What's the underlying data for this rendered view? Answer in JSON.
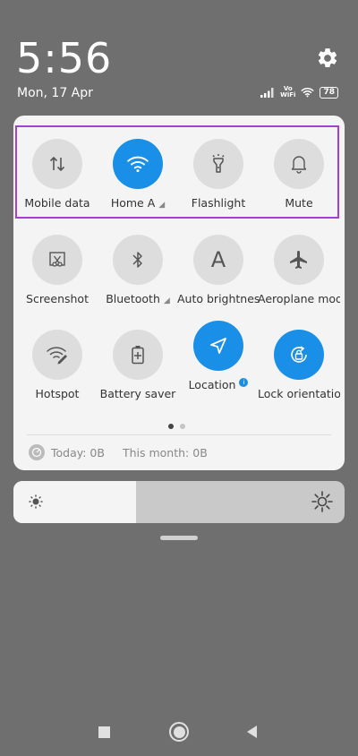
{
  "status": {
    "time": "5:56",
    "date": "Mon, 17 Apr",
    "vowifi_line1": "Vo",
    "vowifi_line2": "WiFi",
    "battery": "78"
  },
  "tiles_row1": [
    {
      "label": "Mobile data",
      "icon": "mobile-data-icon",
      "on": false
    },
    {
      "label": "Home A",
      "icon": "wifi-icon",
      "on": true
    },
    {
      "label": "Flashlight",
      "icon": "flashlight-icon",
      "on": false
    },
    {
      "label": "Mute",
      "icon": "bell-icon",
      "on": false
    }
  ],
  "tiles_row2": [
    {
      "label": "Screenshot",
      "icon": "screenshot-icon",
      "on": false
    },
    {
      "label": "Bluetooth",
      "icon": "bluetooth-icon",
      "on": false
    },
    {
      "label": "Auto brightness",
      "icon": "auto-brightness-icon",
      "on": false
    },
    {
      "label": "Aeroplane mode",
      "icon": "airplane-icon",
      "on": false
    }
  ],
  "tiles_row3": [
    {
      "label": "Hotspot",
      "icon": "hotspot-icon",
      "on": false
    },
    {
      "label": "Battery saver",
      "icon": "battery-saver-icon",
      "on": false
    },
    {
      "label": "Location",
      "icon": "location-icon",
      "on": true
    },
    {
      "label": "Lock orientation",
      "icon": "lock-orientation-icon",
      "on": true
    }
  ],
  "auto_brightness_glyph": "A",
  "usage": {
    "today": "Today: 0B",
    "month": "This month: 0B"
  },
  "brightness_level": 0.37,
  "colors": {
    "accent": "#1a8fe8",
    "highlight": "#a33fd2",
    "background": "#6f6f6f"
  }
}
